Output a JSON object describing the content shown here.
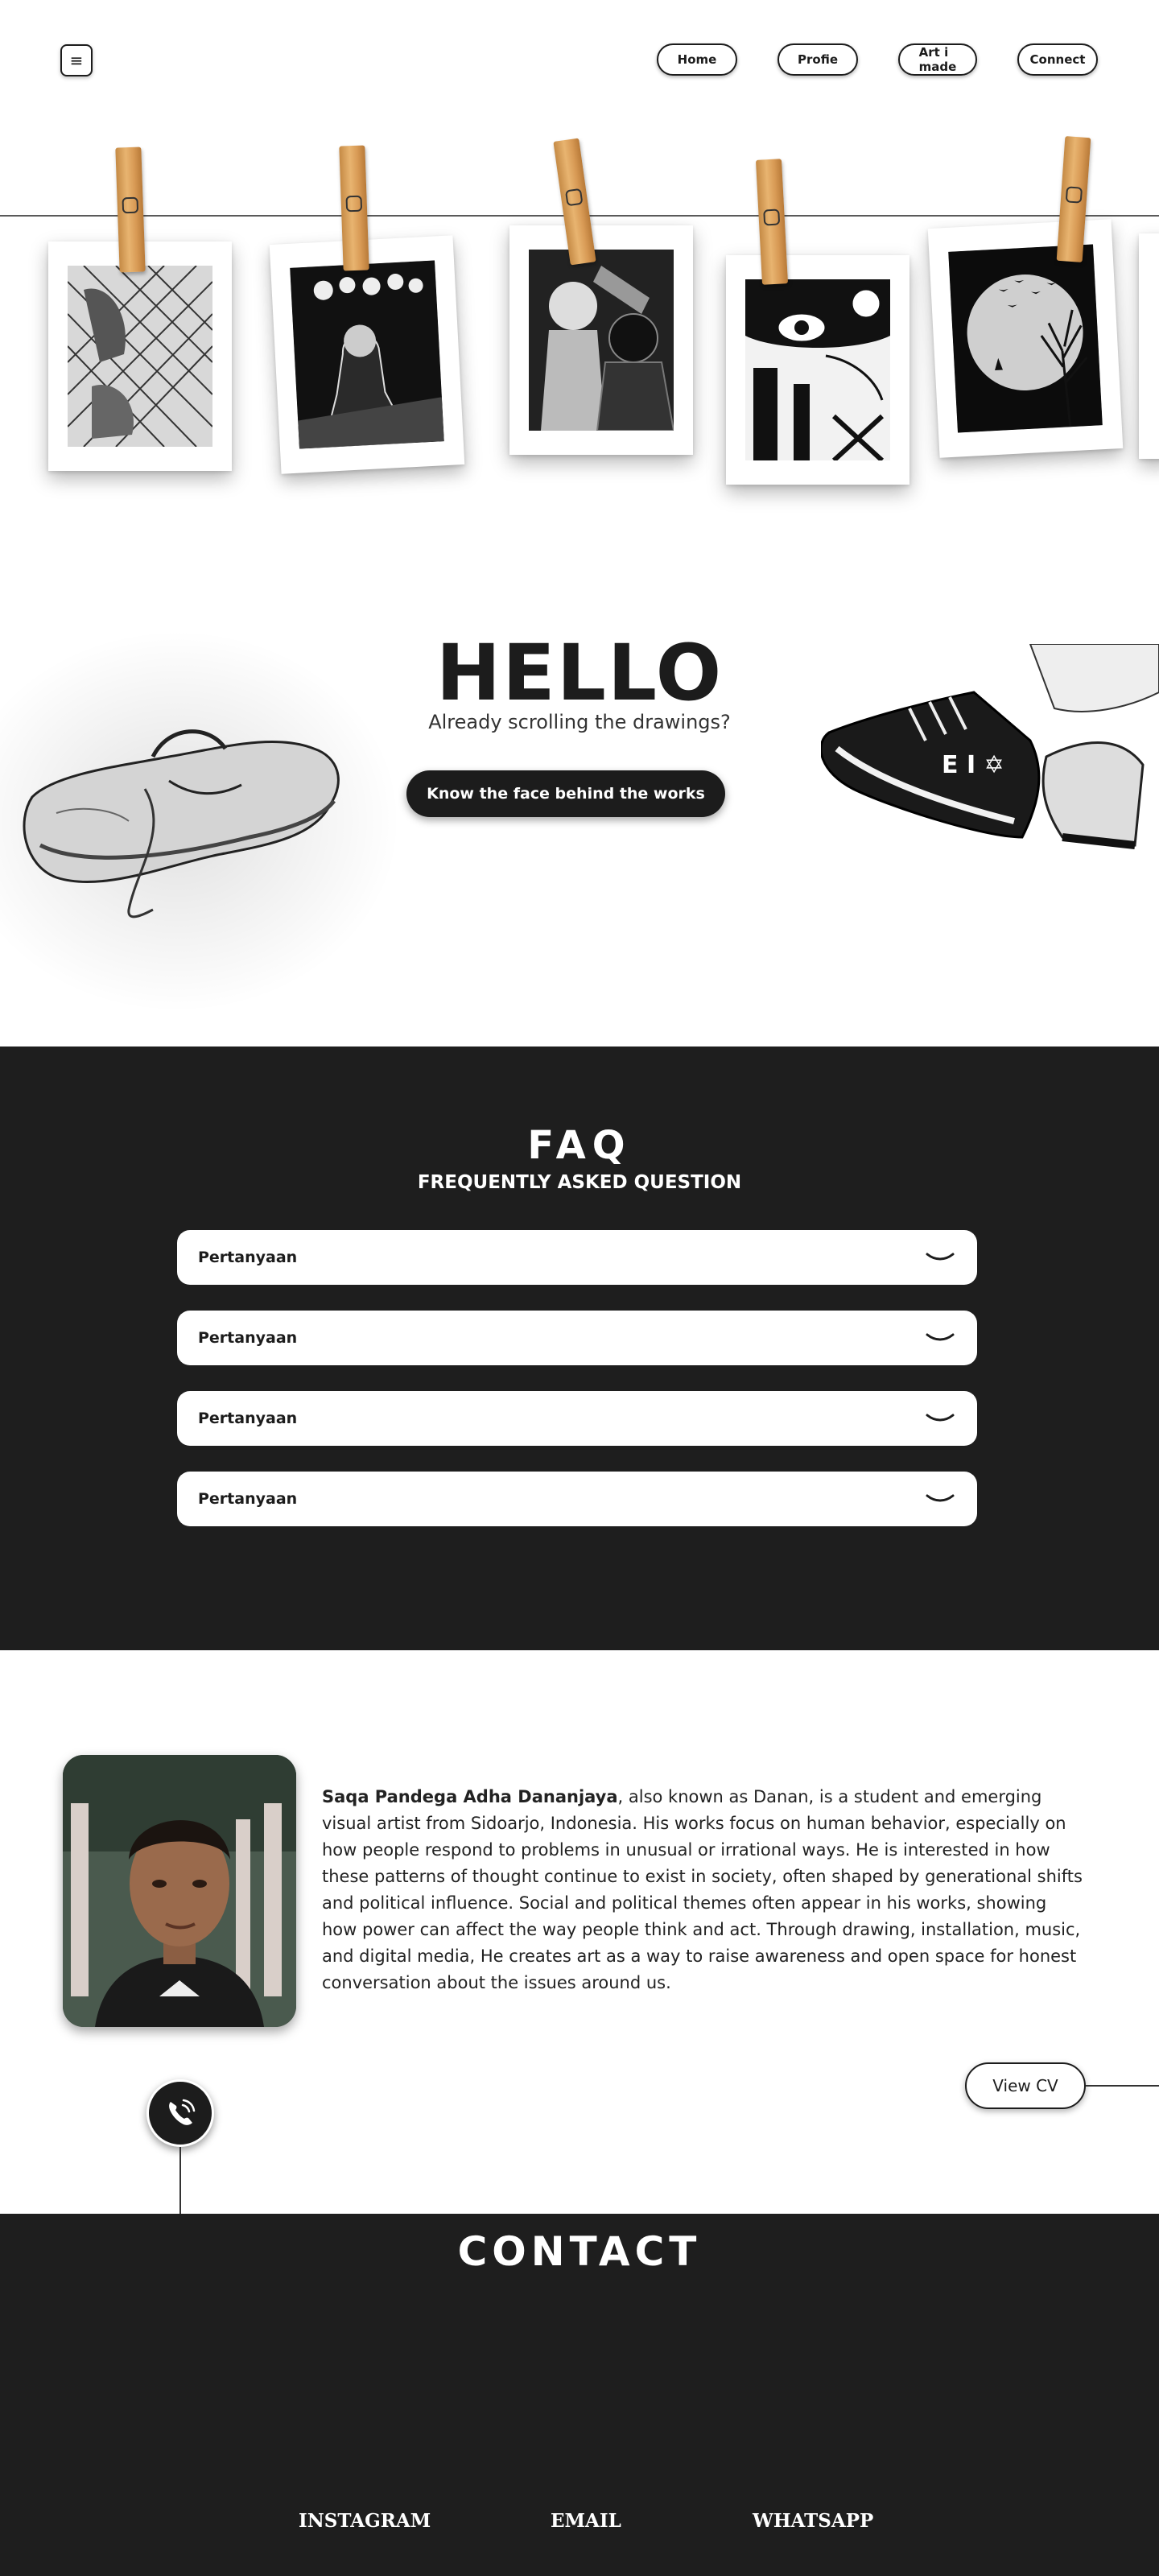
{
  "header": {
    "menu_icon": "hamburger-icon",
    "nav": [
      {
        "label": "Home"
      },
      {
        "label": "Profie"
      },
      {
        "label": "Art i made"
      },
      {
        "label": "Connect"
      }
    ]
  },
  "gallery": {
    "artworks": [
      {
        "subject": "fence-hands-drawing"
      },
      {
        "subject": "crowd-concert-drawing"
      },
      {
        "subject": "two-figures-drawing"
      },
      {
        "subject": "surreal-eye-drawing"
      },
      {
        "subject": "moon-tree-drawing"
      }
    ]
  },
  "hero": {
    "title": "HELLO",
    "subtitle": "Already scrolling the drawings?",
    "cta_label": "Know the face behind the works"
  },
  "faq": {
    "title": "FAQ",
    "subtitle": "FREQUENTLY ASKED QUESTION",
    "items": [
      {
        "question": "Pertanyaan"
      },
      {
        "question": "Pertanyaan"
      },
      {
        "question": "Pertanyaan"
      },
      {
        "question": "Pertanyaan"
      }
    ]
  },
  "about": {
    "name": "Saqa Pandega Adha Dananjaya",
    "bio_rest": ", also known as Danan, is a student and emerging visual artist from Sidoarjo, Indonesia. His works focus on human behavior, especially on how people respond to problems in unusual or irrational ways. He is interested in how these patterns of thought continue to exist in society, often shaped by generational shifts and political influence. Social and political themes often appear in his works, showing how power can affect the way people think and act. Through drawing, installation, music, and digital media, He creates art as a way to raise awareness and open space for honest conversation about the issues around us.",
    "cv_label": "View CV",
    "phone_icon": "phone-icon"
  },
  "contact": {
    "title": "CONTACT",
    "links": [
      {
        "label": "INSTAGRAM"
      },
      {
        "label": "EMAIL"
      },
      {
        "label": "WHATSAPP"
      }
    ]
  },
  "colors": {
    "dark": "#1e1e1e",
    "light": "#ffffff",
    "clothespin": "#dca25e"
  }
}
